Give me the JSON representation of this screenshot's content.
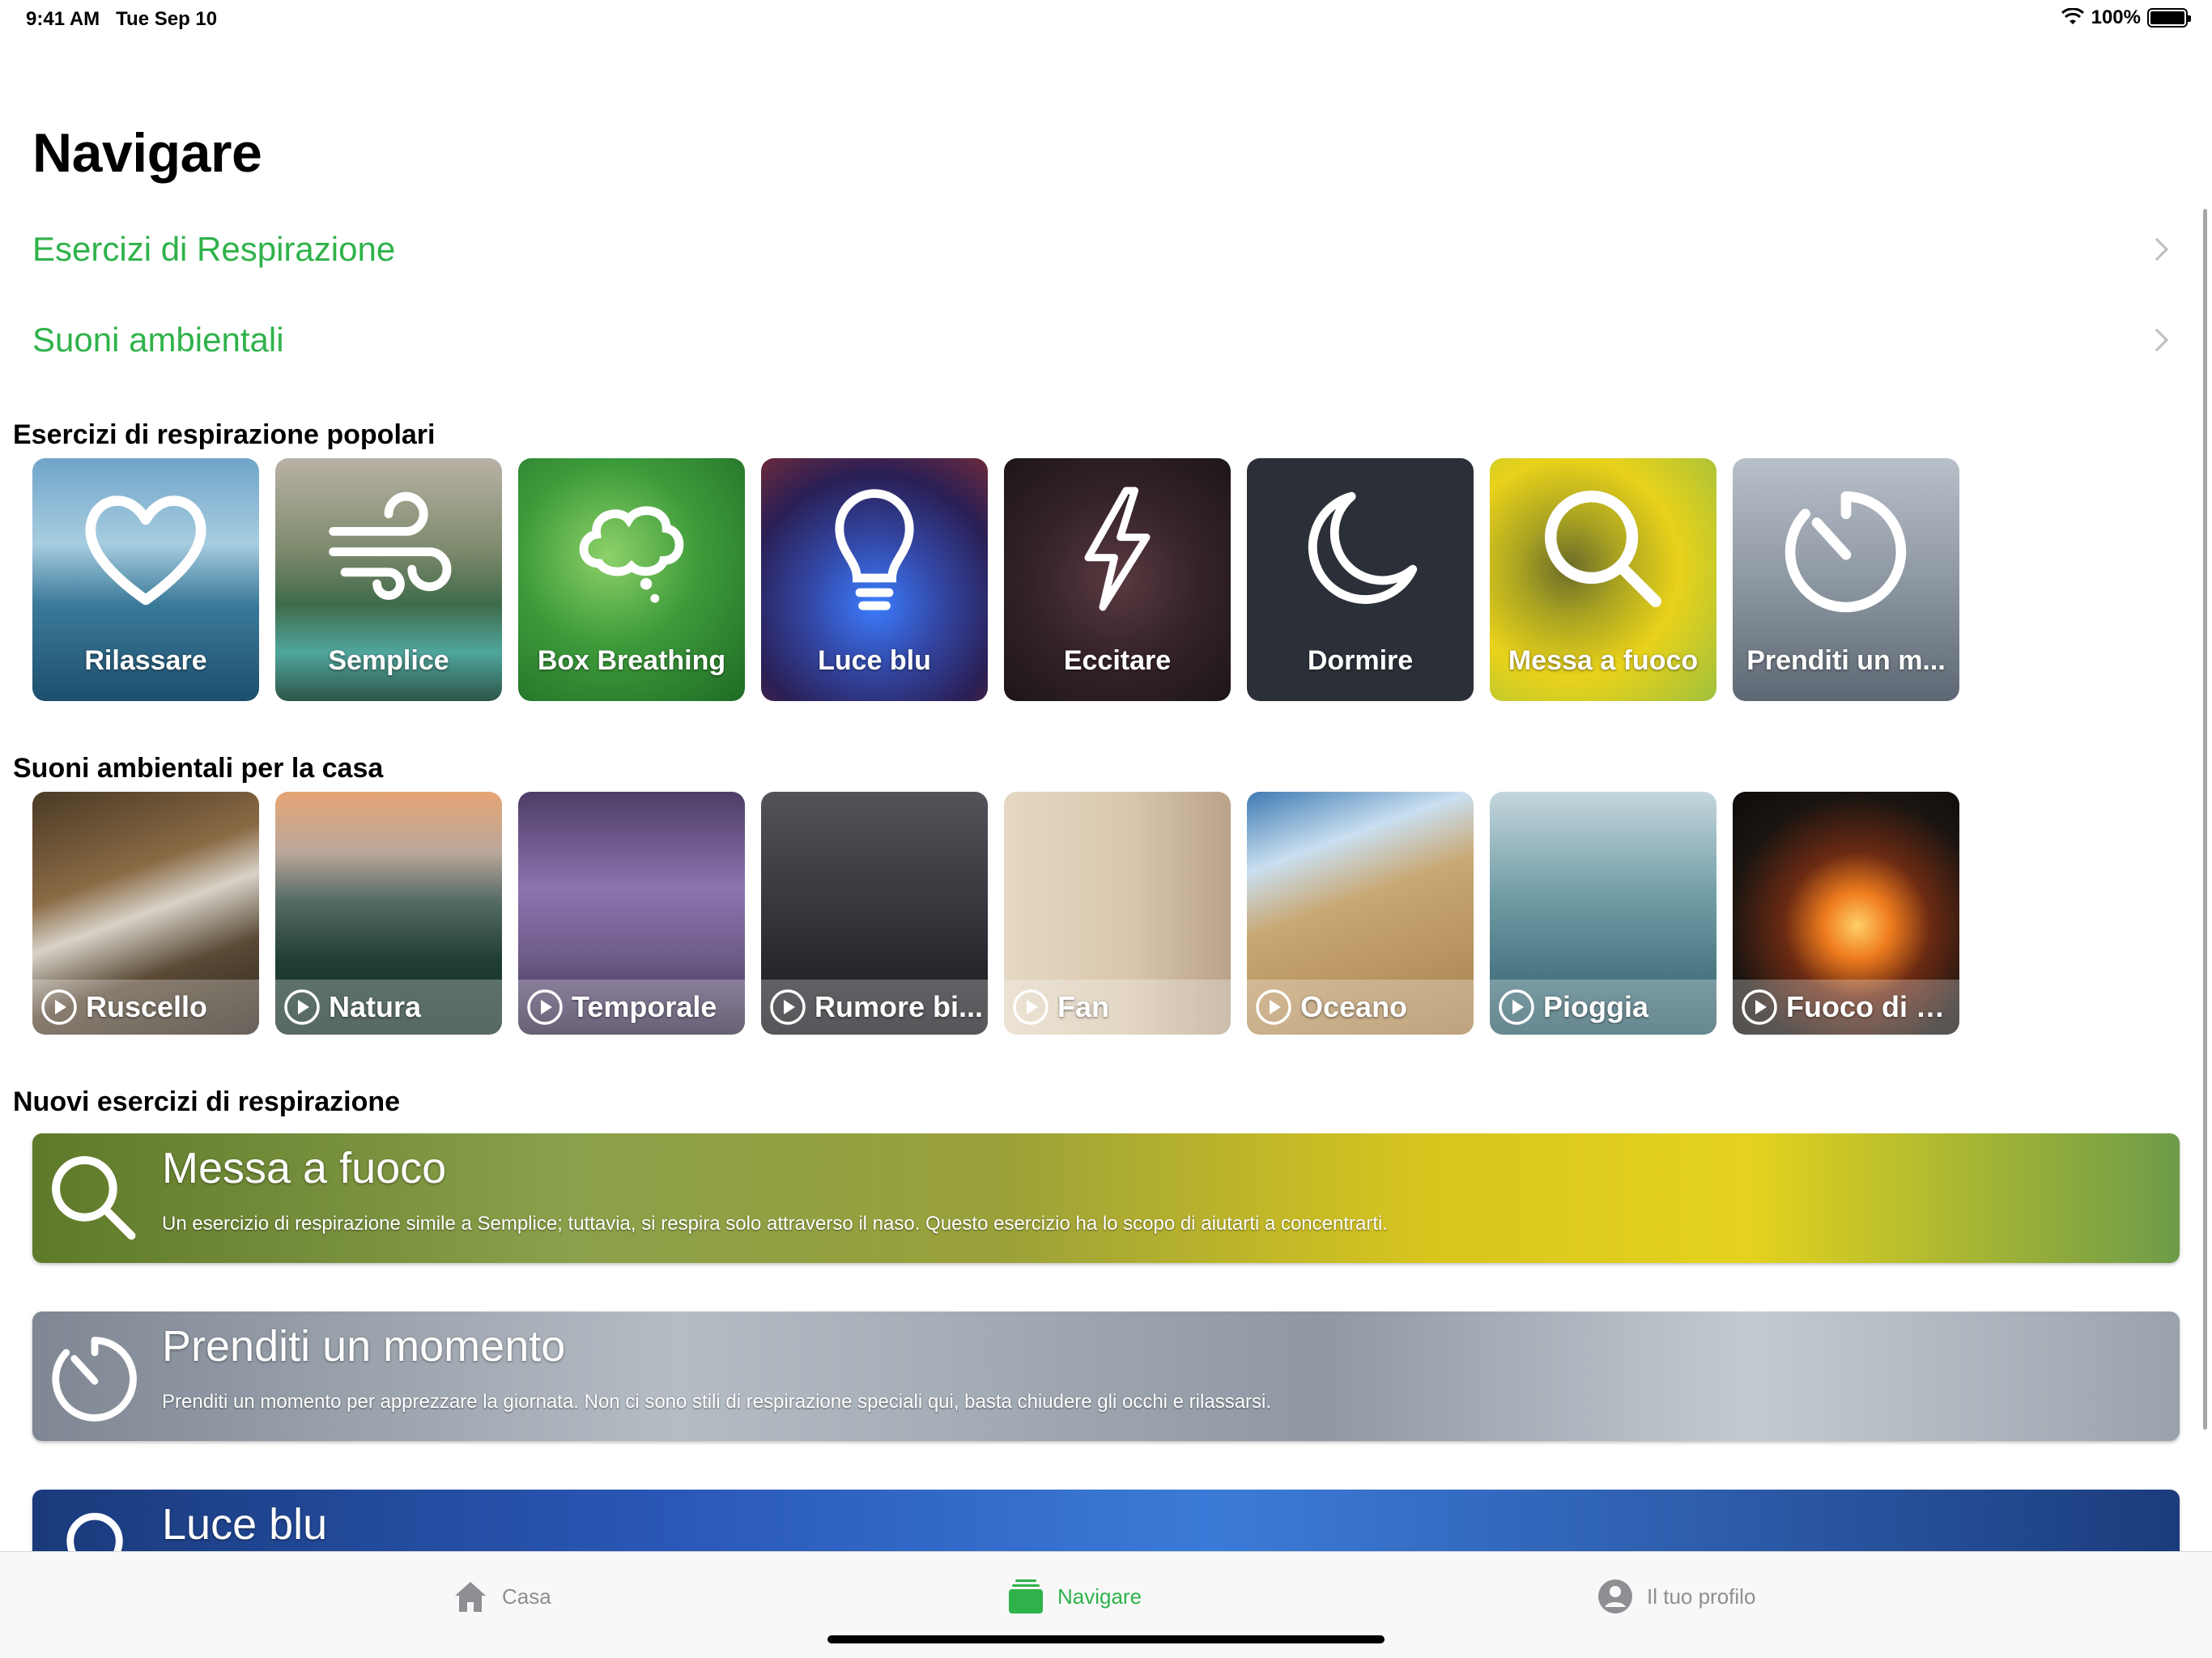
{
  "status_bar": {
    "time": "9:41 AM",
    "date": "Tue Sep 10",
    "battery": "100%"
  },
  "page_title": "Navigare",
  "nav_rows": [
    {
      "label": "Esercizi di Respirazione"
    },
    {
      "label": "Suoni ambientali"
    }
  ],
  "sections": {
    "popular": "Esercizi di respirazione popolari",
    "sounds": "Suoni ambientali per la casa",
    "new": "Nuovi esercizi di respirazione"
  },
  "breathing_tiles": [
    {
      "label": "Rilassare",
      "icon": "heart-icon"
    },
    {
      "label": "Semplice",
      "icon": "wind-icon"
    },
    {
      "label": "Box Breathing",
      "icon": "thought-bubble-icon"
    },
    {
      "label": "Luce blu",
      "icon": "lightbulb-icon"
    },
    {
      "label": "Eccitare",
      "icon": "lightning-icon"
    },
    {
      "label": "Dormire",
      "icon": "moon-icon"
    },
    {
      "label": "Messa a fuoco",
      "icon": "magnifier-icon"
    },
    {
      "label": "Prenditi un m...",
      "icon": "timer-icon"
    }
  ],
  "sound_tiles": [
    {
      "label": "Ruscello"
    },
    {
      "label": "Natura"
    },
    {
      "label": "Temporale"
    },
    {
      "label": "Rumore bi..."
    },
    {
      "label": "Fan"
    },
    {
      "label": "Oceano"
    },
    {
      "label": "Pioggia"
    },
    {
      "label": "Fuoco di Bi..."
    }
  ],
  "banners": [
    {
      "title": "Messa a fuoco",
      "desc": "Un esercizio di respirazione simile a Semplice; tuttavia, si respira solo attraverso il naso. Questo esercizio ha lo scopo di aiutarti a concentrarti.",
      "icon": "magnifier-icon"
    },
    {
      "title": "Prenditi un momento",
      "desc": "Prenditi un momento per apprezzare la giornata. Non ci sono stili di respirazione speciali qui, basta chiudere gli occhi e rilassarsi.",
      "icon": "timer-icon"
    },
    {
      "title": "Luce blu",
      "icon": "lightbulb-icon"
    }
  ],
  "tab_bar": {
    "home": "Casa",
    "browse": "Navigare",
    "profile": "Il tuo profilo"
  },
  "colors": {
    "accent": "#2fb24a",
    "inactive": "#8e8e93"
  }
}
